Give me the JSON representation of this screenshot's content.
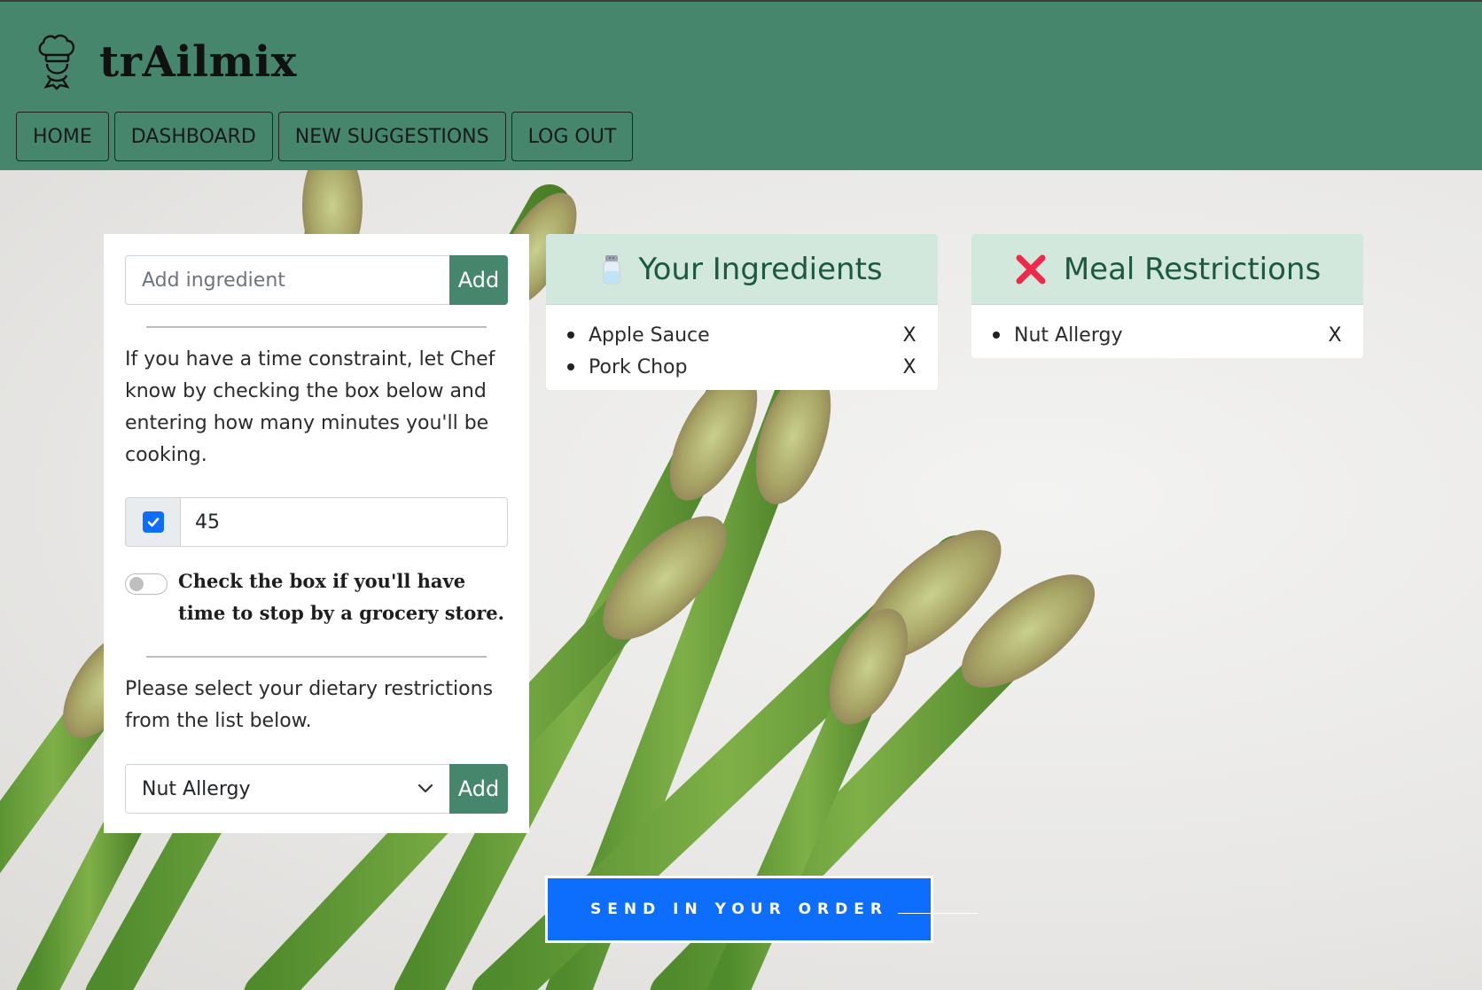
{
  "brand": {
    "title": "trAilmix",
    "icon": "chef-icon"
  },
  "nav": {
    "home": "HOME",
    "dashboard": "DASHBOARD",
    "new_suggestions": "NEW SUGGESTIONS",
    "log_out": "LOG OUT"
  },
  "ingredient_form": {
    "placeholder": "Add ingredient",
    "add_label": "Add"
  },
  "time_constraint": {
    "description": "If you have a time constraint, let Chef know by checking the box below and entering how many minutes you'll be cooking.",
    "checked": true,
    "minutes": "45"
  },
  "grocery": {
    "label": "Check the box if you'll have time to stop by a grocery store.",
    "enabled": false
  },
  "dietary": {
    "description": "Please select your dietary restrictions from the list below.",
    "selected": "Nut Allergy",
    "add_label": "Add"
  },
  "ingredients_card": {
    "title": "Your Ingredients",
    "icon": "salt-shaker-icon",
    "items": [
      {
        "name": "Apple Sauce",
        "remove": "X"
      },
      {
        "name": "Pork Chop",
        "remove": "X"
      }
    ]
  },
  "restrictions_card": {
    "title": "Meal Restrictions",
    "icon": "red-cross-icon",
    "items": [
      {
        "name": "Nut Allergy",
        "remove": "X"
      }
    ]
  },
  "send_order": {
    "label": "SEND IN YOUR ORDER"
  },
  "colors": {
    "header": "#46866d",
    "card_header": "#d3e8dd",
    "primary": "#0d6efd",
    "add_button": "#46866d"
  }
}
